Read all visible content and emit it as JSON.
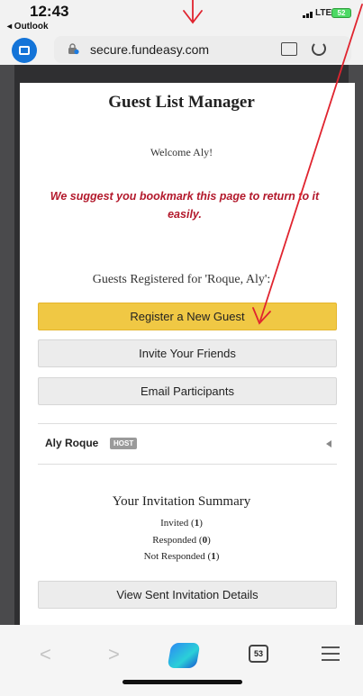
{
  "status_bar": {
    "time": "12:43",
    "back_app": "◂ Outlook",
    "network": "LTE",
    "battery": "52"
  },
  "url_bar": {
    "url": "secure.fundeasy.com"
  },
  "page": {
    "title": "Guest List Manager",
    "welcome": "Welcome Aly!",
    "bookmark_notice": "We suggest you bookmark this page to return to it easily.",
    "guests_registered": "Guests Registered for 'Roque, Aly':",
    "buttons": {
      "register": "Register a New Guest",
      "invite": "Invite Your Friends",
      "email": "Email Participants",
      "view_sent": "View Sent Invitation Details"
    },
    "host": {
      "name": "Aly Roque",
      "badge": "HOST"
    },
    "summary": {
      "title": "Your Invitation Summary",
      "invited_label": "Invited (",
      "invited_count": "1",
      "responded_label": "Responded (",
      "responded_count": "0",
      "not_responded_label": "Not Responded (",
      "not_responded_count": "1",
      "close_paren": ")"
    }
  },
  "toolbar": {
    "tab_count": "53"
  },
  "colors": {
    "primary_button": "#f0c844",
    "notice_red": "#b3192c",
    "annotation_red": "#e0242f"
  }
}
